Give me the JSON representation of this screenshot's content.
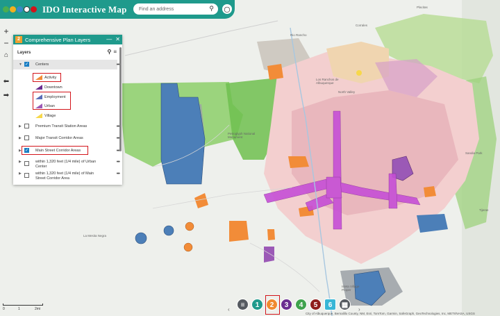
{
  "app": {
    "title": "IDO Interactive Map",
    "search_placeholder": "Find an address"
  },
  "map_controls": {
    "zoom_in": "+",
    "zoom_out": "−",
    "home": "⌂",
    "back": "⬅"
  },
  "panel": {
    "badge": "2",
    "title": "Comprehensive Plan Layers",
    "layers_heading": "Layers",
    "items": [
      {
        "label": "Centers",
        "checked": true,
        "expanded": true
      },
      {
        "label": "Premium Transit Station Areas",
        "checked": false
      },
      {
        "label": "Major Transit Corridor Areas",
        "checked": false
      },
      {
        "label": "Main Street Corridor Areas",
        "checked": true
      },
      {
        "label": "within 1,320 feet (1/4 mile) of Urban Center",
        "checked": false
      },
      {
        "label": "within 1,320 feet (1/4 mile) of Main Street Corridor Area",
        "checked": false
      }
    ],
    "sub_items": [
      {
        "label": "Activity",
        "color": "#f28c38"
      },
      {
        "label": "Downtown",
        "color": "#6a2c91"
      },
      {
        "label": "Employment",
        "color": "#5a6db8"
      },
      {
        "label": "Urban",
        "color": "#9b59b6"
      },
      {
        "label": "Village",
        "color": "#f7d84a"
      }
    ],
    "more": "•••"
  },
  "bottom_buttons": [
    {
      "label": "≡",
      "color": "#555a60"
    },
    {
      "label": "1",
      "color": "#1f9a8c"
    },
    {
      "label": "2",
      "color": "#f08a30"
    },
    {
      "label": "3",
      "color": "#6a2c91"
    },
    {
      "label": "4",
      "color": "#3fa34d"
    },
    {
      "label": "5",
      "color": "#8e1c1c"
    },
    {
      "label": "6",
      "color": "#38b6d6"
    },
    {
      "label": "▦",
      "color": "#555a60"
    }
  ],
  "scale": {
    "ticks": [
      "0",
      "1",
      "2mi"
    ]
  },
  "attribution": "City of Albuquerque, Bernalillo County, NM, Esri, TomTom, Garmin, SafeGraph, GeoTechnologies, Inc, METI/NASA, USGS",
  "map_labels": [
    "Placitas",
    "Sandia Park",
    "Corrales",
    "North Valley",
    "Petroglyph National Monument",
    "Rio Rancho",
    "Los Ranchos de Albuquerque",
    "La Mesita Negra",
    "Tijeras",
    "Isleta Village Proper"
  ]
}
